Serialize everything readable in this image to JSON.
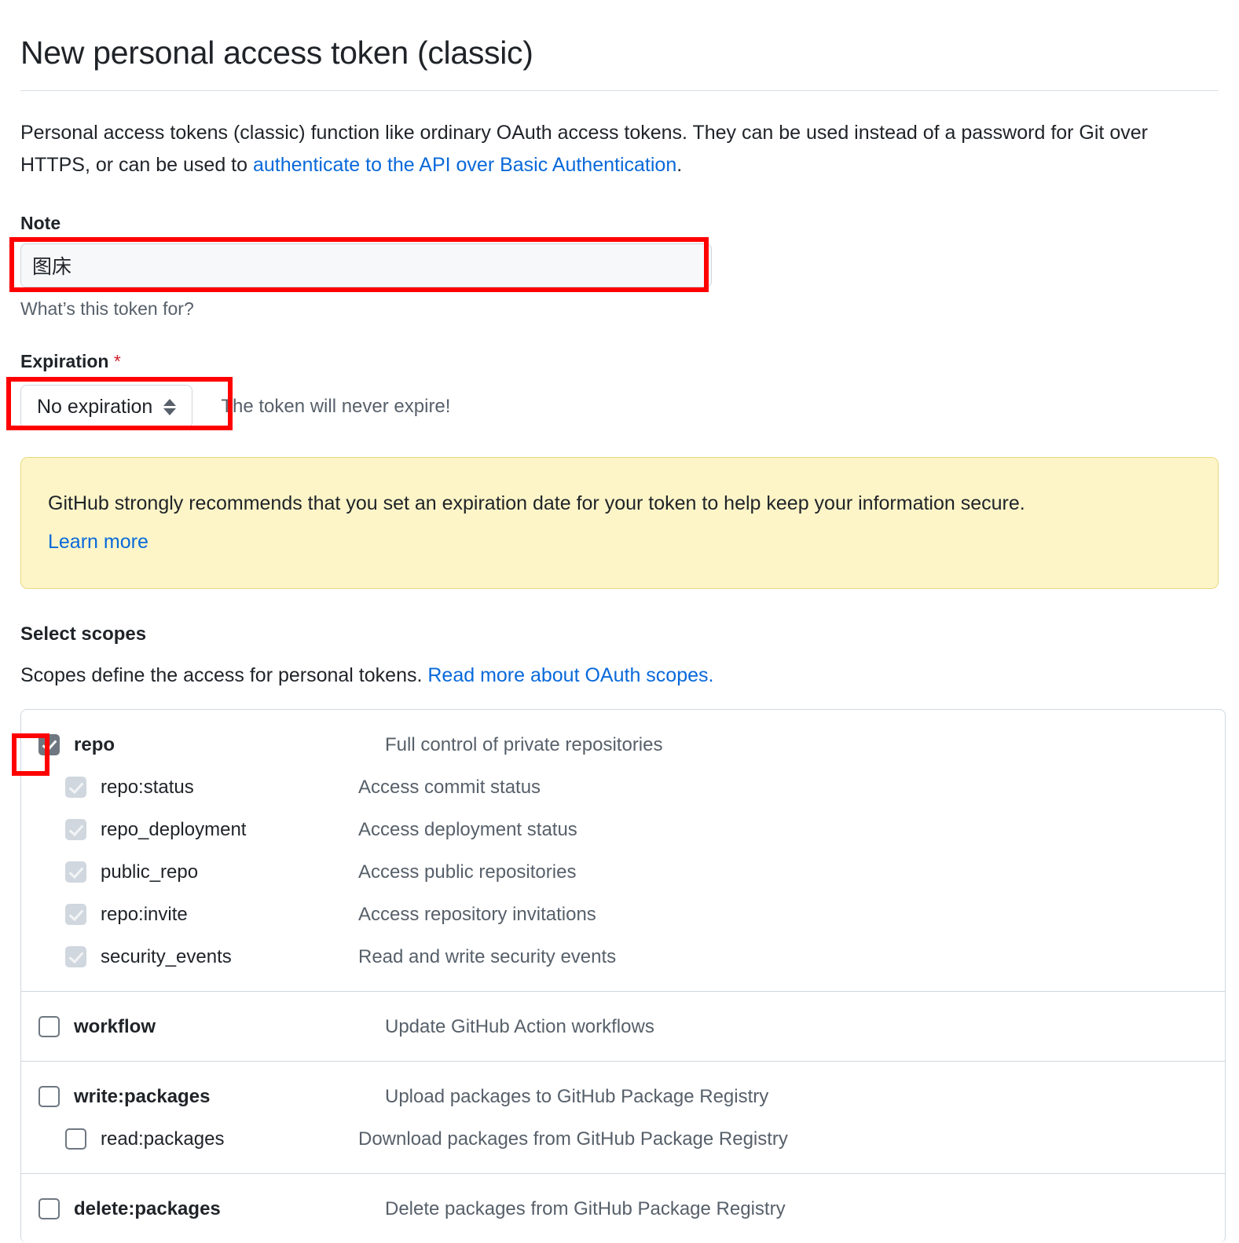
{
  "page": {
    "title": "New personal access token (classic)",
    "intro_before_link": "Personal access tokens (classic) function like ordinary OAuth access tokens. They can be used instead of a password for Git over HTTPS, or can be used to ",
    "intro_link": "authenticate to the API over Basic Authentication",
    "intro_after_link": "."
  },
  "note": {
    "label": "Note",
    "value": "图床",
    "placeholder": "What's this token for?",
    "helper": "What’s this token for?"
  },
  "expiration": {
    "label": "Expiration",
    "required_marker": "*",
    "selected": "No expiration",
    "note": "The token will never expire!",
    "caret_icon": "select-updown-icon"
  },
  "warning": {
    "text": "GitHub strongly recommends that you set an expiration date for your token to help keep your information secure.",
    "link": "Learn more",
    "bg_color": "#fdf5c8",
    "border_color": "#e9d97e"
  },
  "scopes": {
    "title": "Select scopes",
    "subtitle_text": "Scopes define the access for personal tokens. ",
    "subtitle_link": "Read more about OAuth scopes.",
    "groups": [
      {
        "rows": [
          {
            "name": "repo",
            "desc": "Full control of private repositories",
            "checked": true,
            "disabled": false,
            "child": false,
            "bold": true
          },
          {
            "name": "repo:status",
            "desc": "Access commit status",
            "checked": true,
            "disabled": true,
            "child": true,
            "bold": false
          },
          {
            "name": "repo_deployment",
            "desc": "Access deployment status",
            "checked": true,
            "disabled": true,
            "child": true,
            "bold": false
          },
          {
            "name": "public_repo",
            "desc": "Access public repositories",
            "checked": true,
            "disabled": true,
            "child": true,
            "bold": false
          },
          {
            "name": "repo:invite",
            "desc": "Access repository invitations",
            "checked": true,
            "disabled": true,
            "child": true,
            "bold": false
          },
          {
            "name": "security_events",
            "desc": "Read and write security events",
            "checked": true,
            "disabled": true,
            "child": true,
            "bold": false
          }
        ]
      },
      {
        "rows": [
          {
            "name": "workflow",
            "desc": "Update GitHub Action workflows",
            "checked": false,
            "disabled": false,
            "child": false,
            "bold": true
          }
        ]
      },
      {
        "rows": [
          {
            "name": "write:packages",
            "desc": "Upload packages to GitHub Package Registry",
            "checked": false,
            "disabled": false,
            "child": false,
            "bold": true
          },
          {
            "name": "read:packages",
            "desc": "Download packages from GitHub Package Registry",
            "checked": false,
            "disabled": false,
            "child": true,
            "bold": false
          }
        ]
      },
      {
        "rows": [
          {
            "name": "delete:packages",
            "desc": "Delete packages from GitHub Package Registry",
            "checked": false,
            "disabled": false,
            "child": false,
            "bold": true
          }
        ]
      }
    ]
  },
  "annotations": {
    "color": "#ff0000",
    "boxes": [
      "note-input-highlight",
      "expiration-select-highlight",
      "repo-checkbox-highlight"
    ]
  },
  "colors": {
    "link": "#0969da",
    "muted_text": "#57606a",
    "body_text": "#1f2328",
    "border": "#d0d7de",
    "input_bg": "#f6f8fa",
    "required": "#cf222e"
  }
}
